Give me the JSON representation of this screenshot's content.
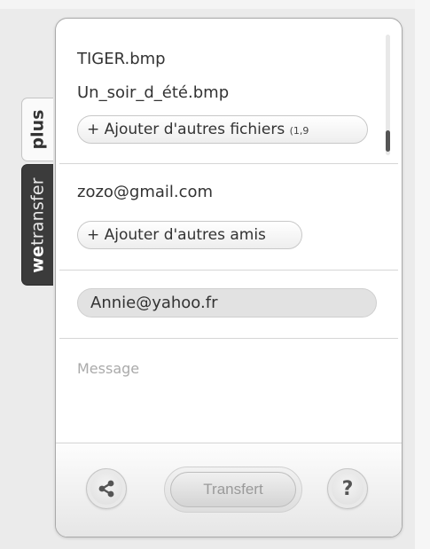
{
  "side_tabs": {
    "plus": "plus",
    "wetransfer_prefix": "we",
    "wetransfer_suffix": "transfer"
  },
  "files": {
    "items": [
      "TIGER.bmp",
      "Un_soir_d_été.bmp"
    ],
    "add_button": "+ Ajouter d'autres fichiers",
    "size_note": "(1,9"
  },
  "friends": {
    "items": [
      "zozo@gmail.com"
    ],
    "add_button": "+ Ajouter d'autres amis"
  },
  "sender": {
    "email": "Annie@yahoo.fr"
  },
  "message": {
    "placeholder": "Message"
  },
  "footer": {
    "transfer_label": "Transfert",
    "help_label": "?",
    "share_icon": "share-icon"
  },
  "colors": {
    "tab_dark": "#3b3b3b",
    "panel_bg": "#ffffff",
    "placeholder": "#aaaaaa"
  }
}
